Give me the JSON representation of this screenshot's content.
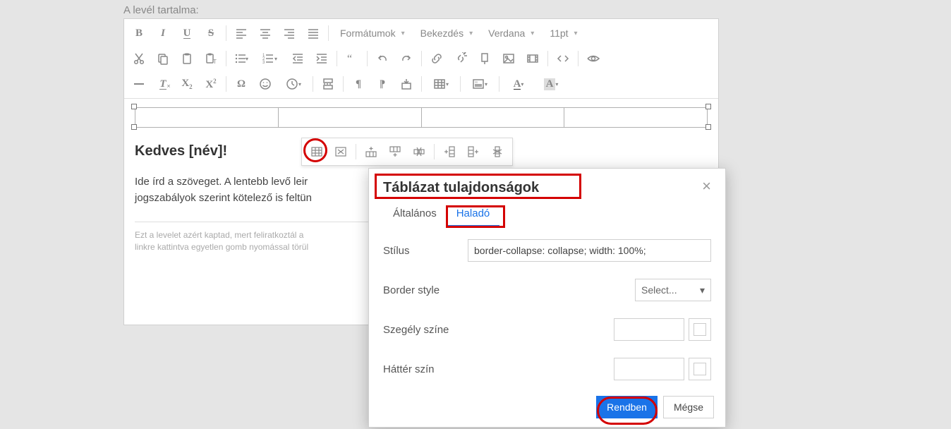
{
  "page_label": "A levél tartalma:",
  "toolbar": {
    "format_dropdown": "Formátumok",
    "paragraph_dropdown": "Bekezdés",
    "font_dropdown": "Verdana",
    "size_dropdown": "11pt"
  },
  "content": {
    "greeting": "Kedves [név]!",
    "body": "Ide írd a szöveget. A lentebb levő leir",
    "body2": "jogszabályok szerint kötelező is feltün",
    "footer1": "Ezt a levelet azért kaptad, mert feliratkoztál a",
    "footer2": "linkre kattintva egyetlen gomb nyomással törül"
  },
  "dialog": {
    "title": "Táblázat tulajdonságok",
    "tab_general": "Általános",
    "tab_advanced": "Haladó",
    "style_label": "Stílus",
    "style_value": "border-collapse: collapse; width: 100%;",
    "border_style_label": "Border style",
    "border_style_value": "Select...",
    "border_color_label": "Szegély színe",
    "bg_color_label": "Háttér szín",
    "ok_label": "Rendben",
    "cancel_label": "Mégse"
  }
}
